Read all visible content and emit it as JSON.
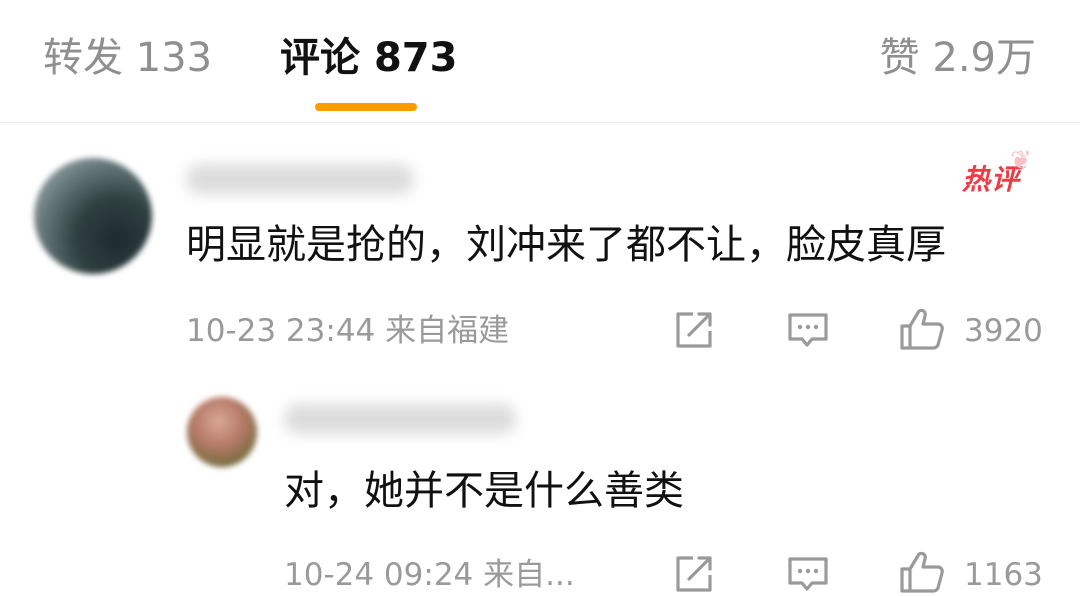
{
  "tabs": {
    "repost": {
      "label": "转发",
      "count": "133"
    },
    "comments": {
      "label": "评论",
      "count": "873"
    },
    "likes": {
      "label": "赞",
      "count": "2.9万"
    }
  },
  "colors": {
    "accent": "#ff9a00",
    "hot": "#ef3b45",
    "meta": "#9a9a9a"
  },
  "comments": [
    {
      "badge": "热评",
      "text": "明显就是抢的，刘冲来了都不让，脸皮真厚",
      "time": "10-23 23:44",
      "location": "来自福建",
      "likes": "3920"
    },
    {
      "text": "对，她并不是什么善类",
      "time": "10-24 09:24",
      "location": "来自...",
      "likes": "1163"
    }
  ],
  "icons": [
    "share-icon",
    "comment-icon",
    "like-icon"
  ]
}
